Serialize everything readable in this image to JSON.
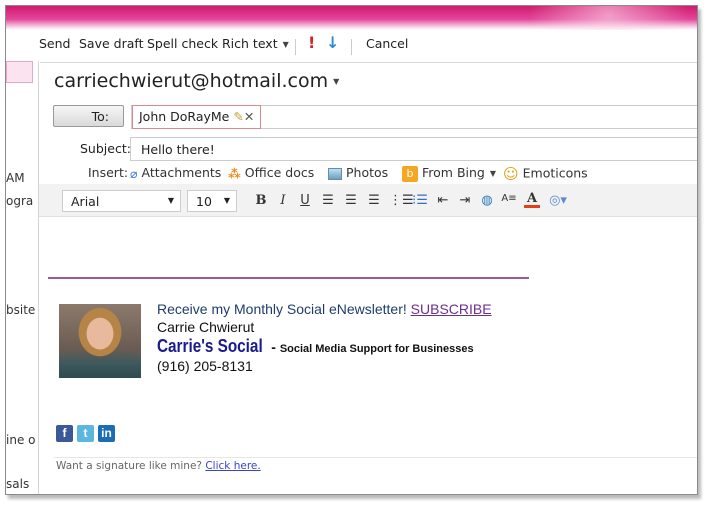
{
  "toolbar": {
    "send": "Send",
    "save_draft": "Save draft",
    "spell_check": "Spell check",
    "rich_text": "Rich text",
    "cancel": "Cancel"
  },
  "sidebar": {
    "fragments": [
      "AM",
      "ogra",
      "bsite",
      "ine o",
      "sals"
    ]
  },
  "compose": {
    "from": "carriechwierut@hotmail.com",
    "to_label": "To:",
    "to_recipient": "John DoRayMe",
    "subject_label": "Subject:",
    "subject_value": "Hello there!",
    "insert_label": "Insert:",
    "insert_items": [
      "Attachments",
      "Office docs",
      "Photos",
      "From Bing",
      "Emoticons"
    ],
    "font": "Arial",
    "font_size": "10",
    "format_buttons": {
      "bold": "B",
      "italic": "I",
      "underline": "U",
      "font_color": "A"
    }
  },
  "signature": {
    "newsletter": "Receive my Monthly Social eNewsletter!",
    "subscribe": "SUBSCRIBE",
    "name": "Carrie Chwierut",
    "brand": "Carrie's Social",
    "dash": "-",
    "tagline": "Social Media Support for Businesses",
    "phone": "(916) 205-8131",
    "social": {
      "facebook": "f",
      "twitter": "t",
      "linkedin": "in"
    },
    "footer_text": "Want a signature like mine?",
    "footer_link": "Click here."
  },
  "colors": {
    "accent": "#d01a6e",
    "brand": "#1a1a8c",
    "link": "#6b2f8f"
  }
}
